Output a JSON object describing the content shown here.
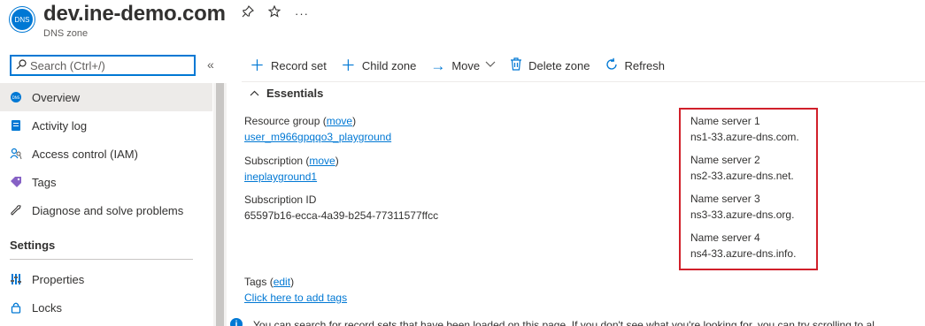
{
  "header": {
    "icon_label": "DNS",
    "title": "dev.ine-demo.com",
    "subtitle": "DNS zone",
    "pin_icon": "pin-icon",
    "star_icon": "star-icon",
    "more_icon": "more-icon"
  },
  "sidebar": {
    "search_placeholder": "Search (Ctrl+/)",
    "collapse_icon": "«",
    "items": [
      {
        "label": "Overview",
        "icon": "dns-overview-icon",
        "active": true
      },
      {
        "label": "Activity log",
        "icon": "activity-log-icon"
      },
      {
        "label": "Access control (IAM)",
        "icon": "iam-icon"
      },
      {
        "label": "Tags",
        "icon": "tag-icon"
      },
      {
        "label": "Diagnose and solve problems",
        "icon": "wrench-icon"
      }
    ],
    "settings_header": "Settings",
    "settings_items": [
      {
        "label": "Properties",
        "icon": "properties-icon"
      },
      {
        "label": "Locks",
        "icon": "lock-icon"
      }
    ]
  },
  "toolbar": {
    "record_set": "Record set",
    "child_zone": "Child zone",
    "move": "Move",
    "delete_zone": "Delete zone",
    "refresh": "Refresh"
  },
  "essentials": {
    "heading": "Essentials",
    "resource_group_label": "Resource group",
    "resource_group_action": "move",
    "resource_group_value": "user_m966gpqqo3_playground",
    "subscription_label": "Subscription",
    "subscription_action": "move",
    "subscription_value": "ineplayground1",
    "subscription_id_label": "Subscription ID",
    "subscription_id_value": "65597b16-ecca-4a39-b254-77311577ffcc",
    "tags_label": "Tags",
    "tags_action": "edit",
    "tags_add": "Click here to add tags",
    "name_servers": [
      {
        "label": "Name server 1",
        "value": "ns1-33.azure-dns.com."
      },
      {
        "label": "Name server 2",
        "value": "ns2-33.azure-dns.net."
      },
      {
        "label": "Name server 3",
        "value": "ns3-33.azure-dns.org."
      },
      {
        "label": "Name server 4",
        "value": "ns4-33.azure-dns.info."
      }
    ]
  },
  "info_bar": {
    "text": "You can search for record sets that have been loaded on this page. If you don't see what you're looking for, you can try scrolling to al"
  },
  "colors": {
    "accent": "#0078d4",
    "highlight_box": "#d1202a",
    "active_nav": "#edebe9"
  }
}
